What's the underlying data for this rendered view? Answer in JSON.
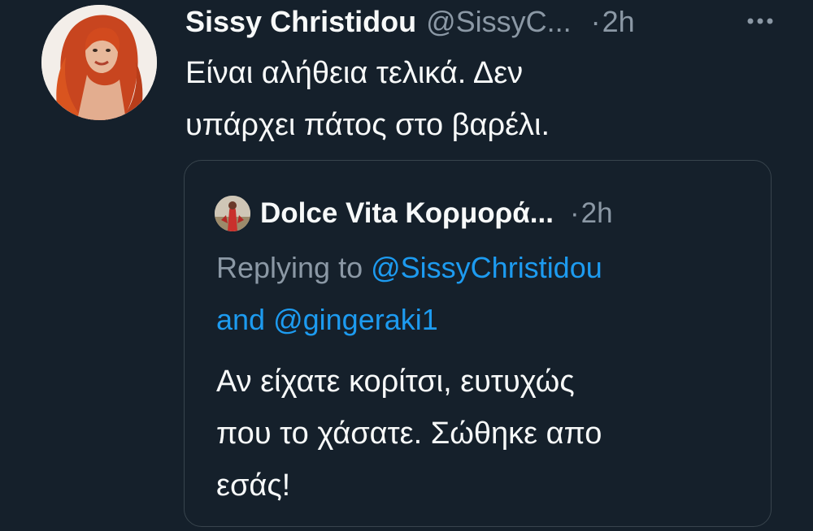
{
  "tweet": {
    "author_name": "Sissy Christidou",
    "author_handle": "@SissyC...",
    "separator": "·",
    "time": "2h",
    "text_lines": [
      "Είναι αλήθεια τελικά. Δεν",
      "υπάρχει πάτος στο βαρέλι."
    ],
    "avatar_icon": "profile-photo-red-hair",
    "more_icon": "more-horizontal-icon"
  },
  "quote": {
    "author_name": "Dolce Vita Κορμορά...",
    "separator": "·",
    "time": "2h",
    "replying_prefix": "Replying to",
    "mention_1": "@SissyChristidou",
    "and_word": "and",
    "mention_2": "@gingeraki1",
    "text_lines": [
      "Αν είχατε κορίτσι, ευτυχώς",
      "που το χάσατε. Σώθηκε απο",
      "εσάς!"
    ],
    "avatar_icon": "profile-photo-figure"
  },
  "colors": {
    "background": "#15202b",
    "text_primary": "#f7f9f9",
    "text_secondary": "#8b98a5",
    "link": "#1d9bf0",
    "border": "#38444d"
  }
}
